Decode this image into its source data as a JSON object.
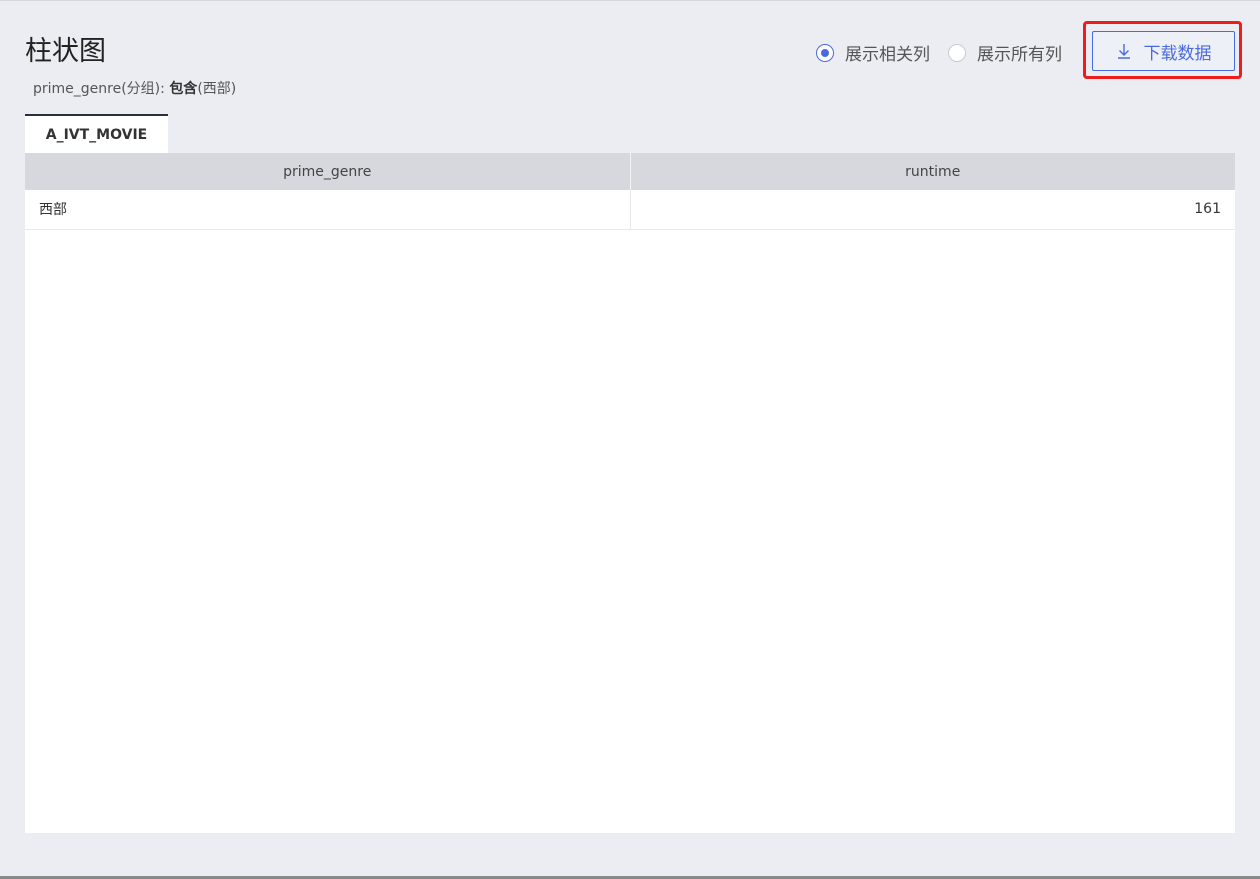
{
  "header": {
    "title": "柱状图",
    "filter": {
      "field": "prime_genre(分组): ",
      "op": "包含",
      "value": "(西部)"
    }
  },
  "view_mode": {
    "options": [
      {
        "label": "展示相关列",
        "checked": true
      },
      {
        "label": "展示所有列",
        "checked": false
      }
    ]
  },
  "toolbar": {
    "download_label": "下载数据",
    "accent_color": "#4a6adf",
    "highlight_color": "#ee1c1c"
  },
  "tabs": [
    {
      "label": "A_IVT_MOVIE",
      "active": true
    }
  ],
  "table": {
    "columns": [
      "prime_genre",
      "runtime"
    ],
    "rows": [
      [
        "西部",
        "161"
      ]
    ]
  }
}
